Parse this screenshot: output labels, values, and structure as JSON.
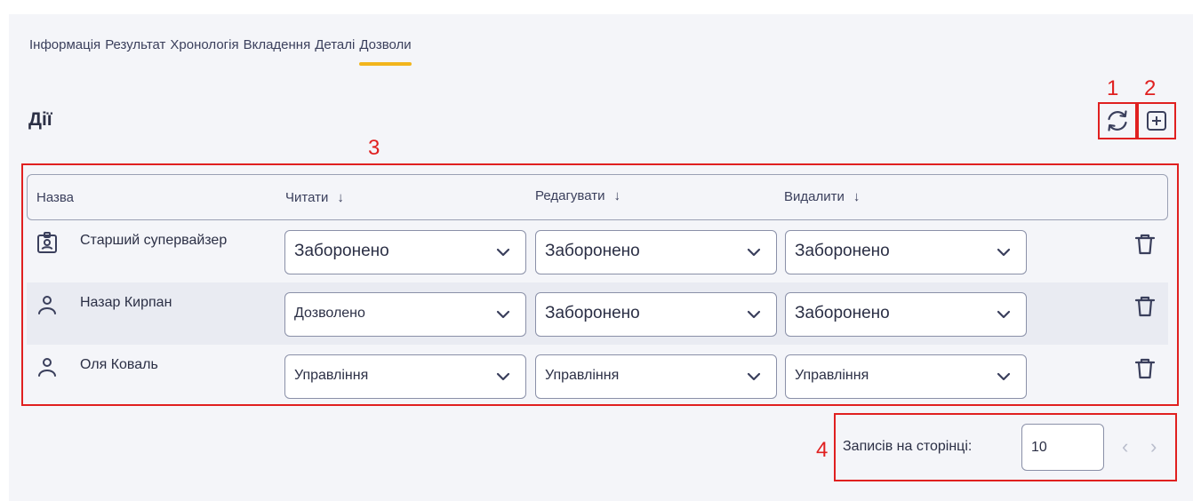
{
  "tabs": [
    {
      "label": "Інформація"
    },
    {
      "label": "Результат"
    },
    {
      "label": "Хронологія"
    },
    {
      "label": "Вкладення"
    },
    {
      "label": "Деталі"
    },
    {
      "label": "Дозволи",
      "active": true
    }
  ],
  "section": {
    "title": "Дії"
  },
  "annotations": {
    "a1": "1",
    "a2": "2",
    "a3": "3",
    "a4": "4",
    "color": "#e02020"
  },
  "table": {
    "headers": {
      "name": "Назва",
      "read": "Читати",
      "edit": "Редагувати",
      "delete": "Видалити",
      "sort_icon": "arrow-down-icon"
    },
    "rows": [
      {
        "name": "Старший супервайзер",
        "icon": "id-badge-icon",
        "read": "Заборонено",
        "edit": "Заборонено",
        "delete": "Заборонено"
      },
      {
        "name": "Назар Кирпан",
        "icon": "user-icon",
        "read": "Дозволено",
        "edit": "Заборонено",
        "delete": "Заборонено"
      },
      {
        "name": "Оля Коваль",
        "icon": "user-icon",
        "read": "Управління",
        "edit": "Управління",
        "delete": "Управління"
      }
    ]
  },
  "pagination": {
    "label": "Записів на сторінці:",
    "page_size": "10"
  },
  "colors": {
    "accent": "#f2b51c",
    "text": "#2b2f45",
    "panel": "#f4f5f9",
    "row_alt": "#e9ebf2"
  }
}
